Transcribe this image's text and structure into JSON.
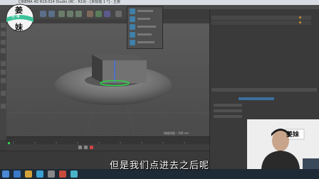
{
  "window": {
    "title": "CINEMA 4D R19.024 Studio (RC - R19) - [未标题 1 *] - 主要"
  },
  "viewport": {
    "camera_label": "透视视图",
    "grid_label": "网格间距 : 100 cm"
  },
  "render_popup": {
    "items": [
      "",
      "",
      "",
      "",
      ""
    ]
  },
  "watermark": {
    "top": "姜",
    "middle": "小 平",
    "bottom": "妹"
  },
  "webcam": {
    "badge": "姜妹"
  },
  "subtitle": "但是我们点进去之后呢",
  "colors": {
    "viewport_bg": "#4a4a4a",
    "torus": "#6e6e6e",
    "accent_green": "#2fd14a",
    "axis_blue": "#3a6bff",
    "taskbar": "#1e2a36"
  }
}
